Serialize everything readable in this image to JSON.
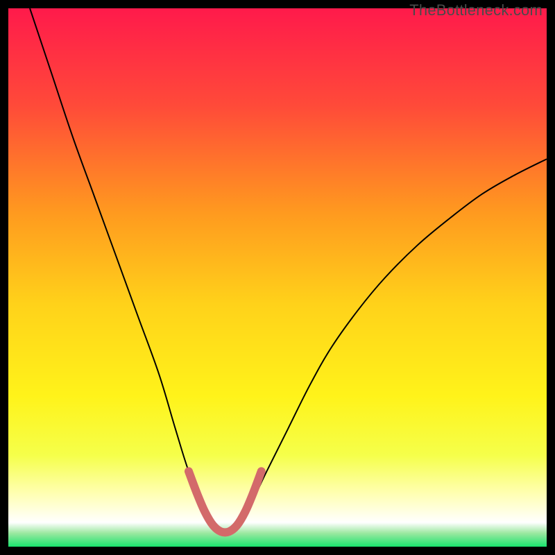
{
  "watermark": "TheBottleneck.com",
  "chart_data": {
    "type": "line",
    "title": "",
    "xlabel": "",
    "ylabel": "",
    "xlim": [
      0,
      100
    ],
    "ylim": [
      0,
      100
    ],
    "grid": false,
    "legend": false,
    "background_gradient": {
      "stops": [
        {
          "offset": 0.0,
          "color": "#ff1a4b"
        },
        {
          "offset": 0.18,
          "color": "#ff4a39"
        },
        {
          "offset": 0.38,
          "color": "#ff9a1f"
        },
        {
          "offset": 0.55,
          "color": "#ffd21a"
        },
        {
          "offset": 0.72,
          "color": "#fff31a"
        },
        {
          "offset": 0.83,
          "color": "#f5ff4a"
        },
        {
          "offset": 0.9,
          "color": "#ffffb0"
        },
        {
          "offset": 0.955,
          "color": "#ffffff"
        },
        {
          "offset": 0.975,
          "color": "#9be8a0"
        },
        {
          "offset": 1.0,
          "color": "#19e36e"
        }
      ]
    },
    "series": [
      {
        "name": "bottleneck-curve",
        "color": "#000000",
        "width": 2,
        "x": [
          4,
          8,
          12,
          16,
          20,
          24,
          28,
          31,
          33.5,
          36,
          38,
          40,
          42,
          45,
          48,
          52,
          56,
          60,
          65,
          70,
          76,
          82,
          88,
          94,
          100
        ],
        "y": [
          100,
          88,
          76,
          65,
          54,
          43,
          32,
          22,
          14,
          8,
          4,
          2.5,
          4,
          8,
          14,
          22,
          30,
          37,
          44,
          50,
          56,
          61,
          65.5,
          69,
          72
        ]
      },
      {
        "name": "optimal-zone-highlight",
        "color": "#d36a6a",
        "width": 12,
        "linecap": "round",
        "x": [
          33.5,
          35,
          36.5,
          38,
          39.5,
          41,
          42.5,
          44,
          45.5,
          47
        ],
        "y": [
          14,
          10,
          6.5,
          4,
          2.8,
          2.8,
          4,
          6.5,
          10,
          14
        ]
      }
    ],
    "annotations": []
  }
}
